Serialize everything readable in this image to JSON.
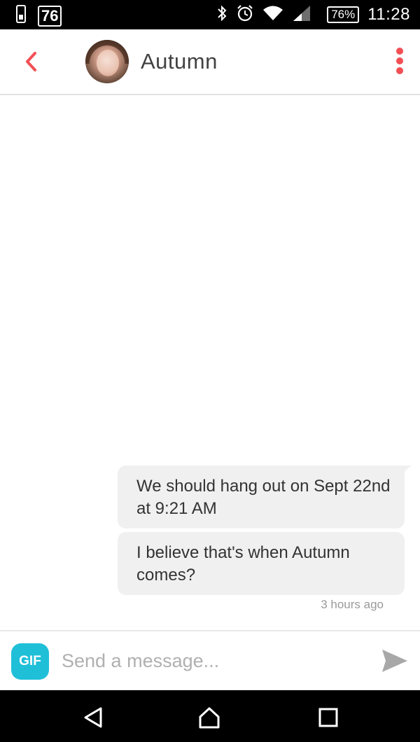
{
  "status_bar": {
    "notification_number": "76",
    "battery_percent": "76%",
    "time": "11:28",
    "icons": [
      "phone-icon",
      "bluetooth-icon",
      "alarm-icon",
      "wifi-icon",
      "cell-signal-icon",
      "battery-icon"
    ]
  },
  "header": {
    "contact_name": "Autumn",
    "back_icon": "chevron-left-icon",
    "menu_icon": "more-vertical-icon",
    "accent_color": "#f24f55"
  },
  "messages": [
    {
      "text": "We should hang out on Sept 22nd at 9:21 AM",
      "direction": "outgoing"
    },
    {
      "text": "I believe that's when Autumn comes?",
      "direction": "outgoing"
    }
  ],
  "timestamp": "3 hours ago",
  "composer": {
    "gif_label": "GIF",
    "placeholder": "Send a message...",
    "gif_color": "#1fbfd8",
    "send_icon": "send-icon"
  },
  "nav_bar": {
    "icons": [
      "nav-back-icon",
      "nav-home-icon",
      "nav-recents-icon"
    ]
  }
}
